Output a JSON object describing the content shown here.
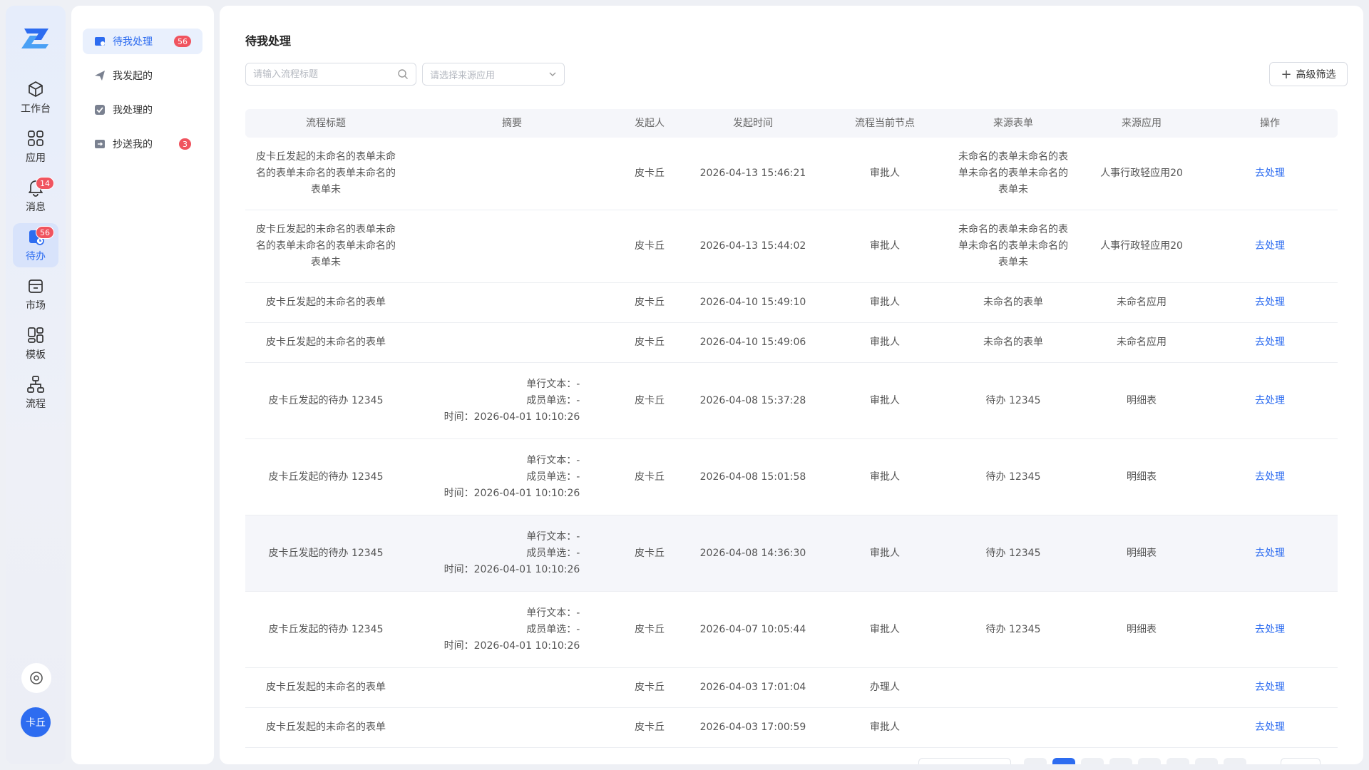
{
  "rail": {
    "items": [
      {
        "label": "工作台",
        "icon": "cube-icon",
        "badge": ""
      },
      {
        "label": "应用",
        "icon": "grid-icon",
        "badge": ""
      },
      {
        "label": "消息",
        "icon": "bell-icon",
        "badge": "14"
      },
      {
        "label": "待办",
        "icon": "todo-icon",
        "badge": "56"
      },
      {
        "label": "市场",
        "icon": "store-icon",
        "badge": ""
      },
      {
        "label": "模板",
        "icon": "template-icon",
        "badge": ""
      },
      {
        "label": "流程",
        "icon": "flow-icon",
        "badge": ""
      }
    ],
    "avatar": "卡丘",
    "accent": "#2d6cf0"
  },
  "subnav": {
    "items": [
      {
        "label": "待我处理",
        "badge": "56"
      },
      {
        "label": "我发起的",
        "badge": ""
      },
      {
        "label": "我处理的",
        "badge": ""
      },
      {
        "label": "抄送我的",
        "badge": "3"
      }
    ]
  },
  "main": {
    "title": "待我处理",
    "search_placeholder": "请输入流程标题",
    "select_placeholder": "请选择来源应用",
    "advanced_filter": "高级筛选"
  },
  "table": {
    "headers": [
      "流程标题",
      "摘要",
      "发起人",
      "发起时间",
      "流程当前节点",
      "来源表单",
      "来源应用",
      "操作"
    ],
    "action_label": "去处理",
    "rows": [
      {
        "title": "皮卡丘发起的未命名的表单未命名的表单未命名的表单未命名的表单未",
        "summary": [],
        "initiator": "皮卡丘",
        "time": "2026-04-13 15:46:21",
        "node": "审批人",
        "form": "未命名的表单未命名的表单未命名的表单未命名的表单未",
        "app": "人事行政轻应用20"
      },
      {
        "title": "皮卡丘发起的未命名的表单未命名的表单未命名的表单未命名的表单未",
        "summary": [],
        "initiator": "皮卡丘",
        "time": "2026-04-13 15:44:02",
        "node": "审批人",
        "form": "未命名的表单未命名的表单未命名的表单未命名的表单未",
        "app": "人事行政轻应用20"
      },
      {
        "title": "皮卡丘发起的未命名的表单",
        "summary": [],
        "initiator": "皮卡丘",
        "time": "2026-04-10 15:49:10",
        "node": "审批人",
        "form": "未命名的表单",
        "app": "未命名应用"
      },
      {
        "title": "皮卡丘发起的未命名的表单",
        "summary": [],
        "initiator": "皮卡丘",
        "time": "2026-04-10 15:49:06",
        "node": "审批人",
        "form": "未命名的表单",
        "app": "未命名应用"
      },
      {
        "title": "皮卡丘发起的待办 12345",
        "summary": [
          "单行文本：-",
          "成员单选：-",
          "时间：2026-04-01 10:10:26"
        ],
        "initiator": "皮卡丘",
        "time": "2026-04-08 15:37:28",
        "node": "审批人",
        "form": "待办 12345",
        "app": "明细表"
      },
      {
        "title": "皮卡丘发起的待办 12345",
        "summary": [
          "单行文本：-",
          "成员单选：-",
          "时间：2026-04-01 10:10:26"
        ],
        "initiator": "皮卡丘",
        "time": "2026-04-08 15:01:58",
        "node": "审批人",
        "form": "待办 12345",
        "app": "明细表"
      },
      {
        "title": "皮卡丘发起的待办 12345",
        "summary": [
          "单行文本：-",
          "成员单选：-",
          "时间：2026-04-01 10:10:26"
        ],
        "initiator": "皮卡丘",
        "time": "2026-04-08 14:36:30",
        "node": "审批人",
        "form": "待办 12345",
        "app": "明细表"
      },
      {
        "title": "皮卡丘发起的待办 12345",
        "summary": [
          "单行文本：-",
          "成员单选：-",
          "时间：2026-04-01 10:10:26"
        ],
        "initiator": "皮卡丘",
        "time": "2026-04-07 10:05:44",
        "node": "审批人",
        "form": "待办 12345",
        "app": "明细表"
      },
      {
        "title": "皮卡丘发起的未命名的表单",
        "summary": [],
        "initiator": "皮卡丘",
        "time": "2026-04-03 17:01:04",
        "node": "办理人",
        "form": "",
        "app": ""
      },
      {
        "title": "皮卡丘发起的未命名的表单",
        "summary": [],
        "initiator": "皮卡丘",
        "time": "2026-04-03 17:00:59",
        "node": "审批人",
        "form": "",
        "app": ""
      }
    ]
  }
}
